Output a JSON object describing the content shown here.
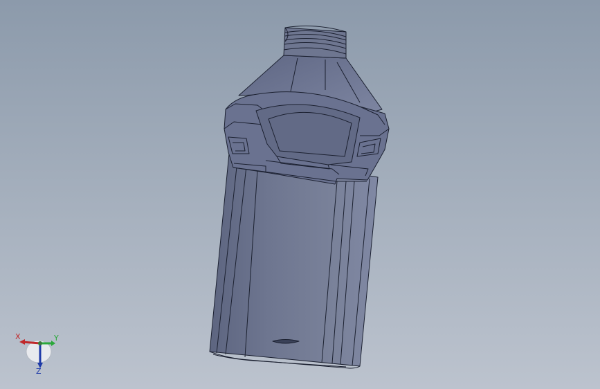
{
  "scene": {
    "model": "bottle",
    "colors": {
      "background_top": "#8c9aab",
      "background_bottom": "#bcc3ce",
      "body_fill": "#6f7890",
      "edge": "#1b2030"
    }
  },
  "triad": {
    "x_label": "X",
    "y_label": "Y",
    "z_label": "Z",
    "colors": {
      "x": "#c0282a",
      "y": "#2aa83a",
      "z": "#1e3aa8"
    }
  }
}
